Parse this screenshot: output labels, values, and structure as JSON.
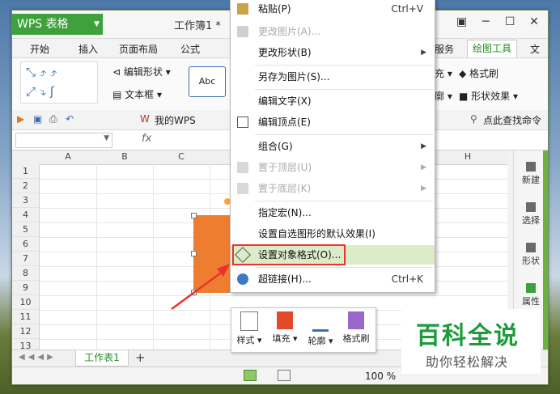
{
  "app": {
    "name": "WPS 表格",
    "doc_title": "工作簿1 *",
    "window_buttons": [
      "▣",
      "─",
      "☐",
      "✕"
    ]
  },
  "menu_tabs": [
    "开始",
    "插入",
    "页面布局",
    "公式",
    "服务",
    "绘图工具",
    "文"
  ],
  "ribbon": {
    "edit_shape": "编辑形状",
    "text_box": "文本框",
    "style_preview": "Abc",
    "fill": "充",
    "format_painter": "格式刷",
    "outline": "廓",
    "shape_effects": "形状效果"
  },
  "toolbar": {
    "my_wps": "我的WPS",
    "find": "点此查找命令"
  },
  "formula_bar": {
    "fx": "fx"
  },
  "columns": [
    "A",
    "B",
    "C",
    "H"
  ],
  "rows": [
    "1",
    "2",
    "3",
    "4",
    "5",
    "6",
    "7",
    "8",
    "9",
    "10",
    "11",
    "12",
    "13"
  ],
  "side_panel": [
    "新建",
    "选择",
    "形状",
    "属性"
  ],
  "context_menu": {
    "items": [
      {
        "label": "粘贴(P)",
        "shortcut": "Ctrl+V",
        "disabled": false
      },
      {
        "label": "更改图片(A)...",
        "disabled": true
      },
      {
        "label": "更改形状(B)",
        "submenu": true,
        "disabled": false
      },
      {
        "label": "另存为图片(S)...",
        "disabled": false
      },
      {
        "label": "编辑文字(X)",
        "disabled": false
      },
      {
        "label": "编辑顶点(E)",
        "disabled": false
      },
      {
        "label": "组合(G)",
        "submenu": true,
        "disabled": false
      },
      {
        "label": "置于顶层(U)",
        "submenu": true,
        "disabled": true
      },
      {
        "label": "置于底层(K)",
        "submenu": true,
        "disabled": true
      },
      {
        "label": "指定宏(N)...",
        "disabled": false
      },
      {
        "label": "设置自选图形的默认效果(I)",
        "disabled": false
      },
      {
        "label": "设置对象格式(O)...",
        "disabled": false,
        "highlighted": true
      },
      {
        "label": "超链接(H)...",
        "shortcut": "Ctrl+K",
        "disabled": false
      }
    ]
  },
  "mini_toolbar": [
    "样式",
    "填充",
    "轮廓",
    "格式刷"
  ],
  "sheet_tabs": {
    "active": "工作表1",
    "add": "+"
  },
  "status": {
    "zoom": "100 %"
  },
  "watermark": {
    "line1": "百科全说",
    "line2": "助你轻松解决"
  },
  "colors": {
    "shape_fill": "#ee7d30",
    "brand_green": "#3fa13b",
    "highlight": "#dcecc9",
    "callout_red": "#e8332c"
  }
}
